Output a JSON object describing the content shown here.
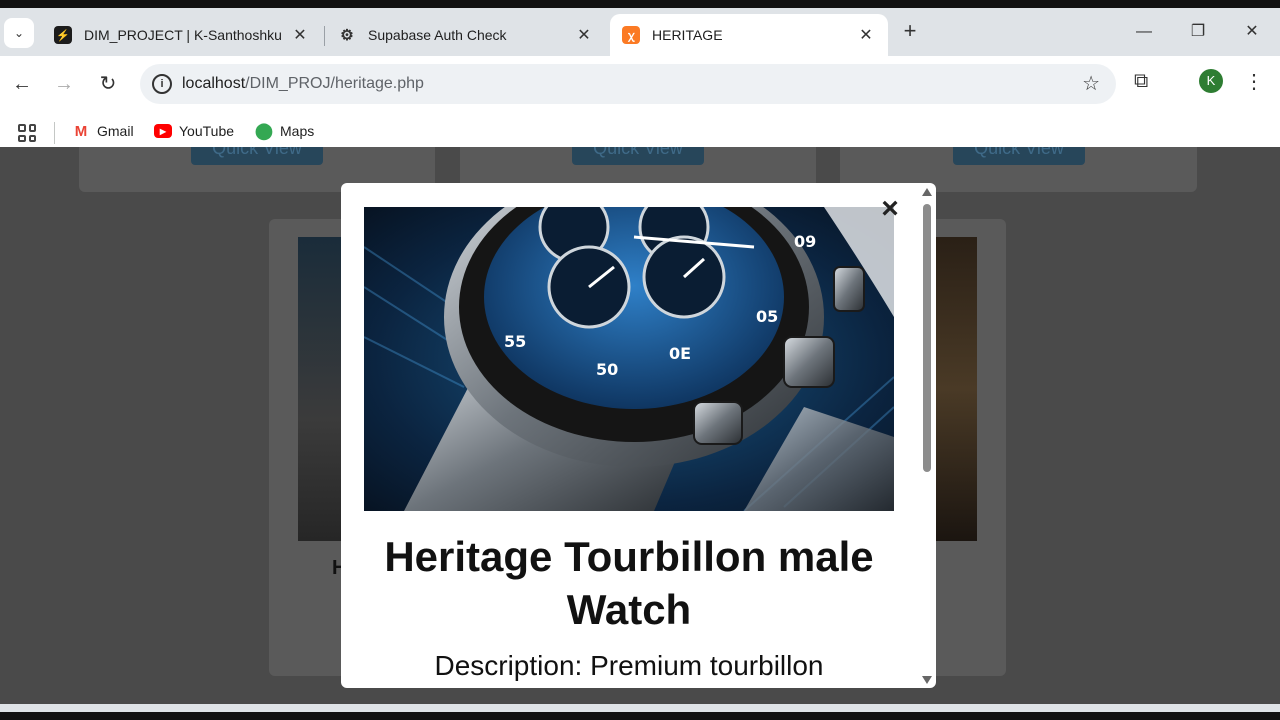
{
  "browser": {
    "tabs": [
      {
        "title": "DIM_PROJECT | K-Santhoshkumar",
        "favicon": "supabase-icon",
        "active": false
      },
      {
        "title": "Supabase Auth Check",
        "favicon": "openai-icon",
        "active": false
      },
      {
        "title": "HERITAGE",
        "favicon": "xampp-icon",
        "active": true
      }
    ],
    "url_host": "localhost",
    "url_path": "/DIM_PROJ/heritage.php",
    "profile_initial": "K",
    "bookmarks": [
      {
        "label": "Gmail",
        "icon": "gmail-icon"
      },
      {
        "label": "YouTube",
        "icon": "youtube-icon"
      },
      {
        "label": "Maps",
        "icon": "maps-icon"
      }
    ]
  },
  "page": {
    "quick_view_label": "Quick View",
    "card_title_initial": "H"
  },
  "modal": {
    "title": "Heritage Tourbillon male Watch",
    "description": "Description: Premium tourbillon",
    "close_label": "×"
  }
}
